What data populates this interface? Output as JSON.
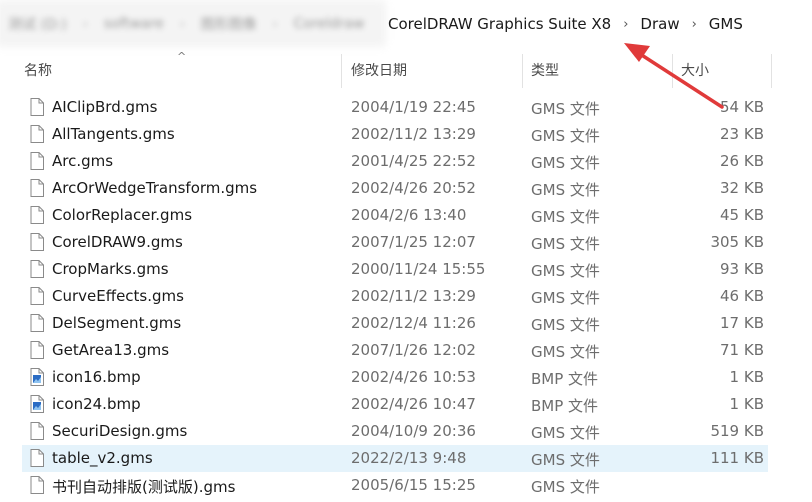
{
  "breadcrumb": {
    "blurred_items": [
      "测试 (D:)",
      "software",
      "图形图像",
      "Coreldraw"
    ],
    "items": [
      {
        "label": "CorelDRAW Graphics Suite X8"
      },
      {
        "label": "Draw"
      },
      {
        "label": "GMS"
      }
    ],
    "separator": "›"
  },
  "columns": {
    "name": "名称",
    "modified": "修改日期",
    "type": "类型",
    "size": "大小",
    "sort_indicator": "^"
  },
  "annotation": {
    "arrow_color": "#e03a3a"
  },
  "selected_color": "#e5f3fb",
  "files": [
    {
      "name": "AIClipBrd.gms",
      "modified": "2004/1/19 22:45",
      "type": "GMS 文件",
      "size": "54 KB",
      "icon": "document-icon"
    },
    {
      "name": "AllTangents.gms",
      "modified": "2002/11/2 13:29",
      "type": "GMS 文件",
      "size": "23 KB",
      "icon": "document-icon"
    },
    {
      "name": "Arc.gms",
      "modified": "2001/4/25 22:52",
      "type": "GMS 文件",
      "size": "26 KB",
      "icon": "document-icon"
    },
    {
      "name": "ArcOrWedgeTransform.gms",
      "modified": "2002/4/26 20:52",
      "type": "GMS 文件",
      "size": "32 KB",
      "icon": "document-icon"
    },
    {
      "name": "ColorReplacer.gms",
      "modified": "2004/2/6 13:40",
      "type": "GMS 文件",
      "size": "45 KB",
      "icon": "document-icon"
    },
    {
      "name": "CorelDRAW9.gms",
      "modified": "2007/1/25 12:07",
      "type": "GMS 文件",
      "size": "305 KB",
      "icon": "document-icon"
    },
    {
      "name": "CropMarks.gms",
      "modified": "2000/11/24 15:55",
      "type": "GMS 文件",
      "size": "93 KB",
      "icon": "document-icon"
    },
    {
      "name": "CurveEffects.gms",
      "modified": "2002/11/2 13:29",
      "type": "GMS 文件",
      "size": "46 KB",
      "icon": "document-icon"
    },
    {
      "name": "DelSegment.gms",
      "modified": "2002/12/4 11:26",
      "type": "GMS 文件",
      "size": "17 KB",
      "icon": "document-icon"
    },
    {
      "name": "GetArea13.gms",
      "modified": "2007/1/26 12:02",
      "type": "GMS 文件",
      "size": "71 KB",
      "icon": "document-icon"
    },
    {
      "name": "icon16.bmp",
      "modified": "2002/4/26 10:53",
      "type": "BMP 文件",
      "size": "1 KB",
      "icon": "image-file-icon"
    },
    {
      "name": "icon24.bmp",
      "modified": "2002/4/26 10:47",
      "type": "BMP 文件",
      "size": "1 KB",
      "icon": "image-file-icon"
    },
    {
      "name": "SecuriDesign.gms",
      "modified": "2004/10/9 20:36",
      "type": "GMS 文件",
      "size": "519 KB",
      "icon": "document-icon"
    },
    {
      "name": "table_v2.gms",
      "modified": "2022/2/13 9:48",
      "type": "GMS 文件",
      "size": "111 KB",
      "icon": "document-icon",
      "selected": true
    },
    {
      "name": "书刊自动排版(测试版).gms",
      "modified": "2005/6/15 15:25",
      "type": "GMS 文件",
      "size": "",
      "icon": "document-icon"
    }
  ]
}
